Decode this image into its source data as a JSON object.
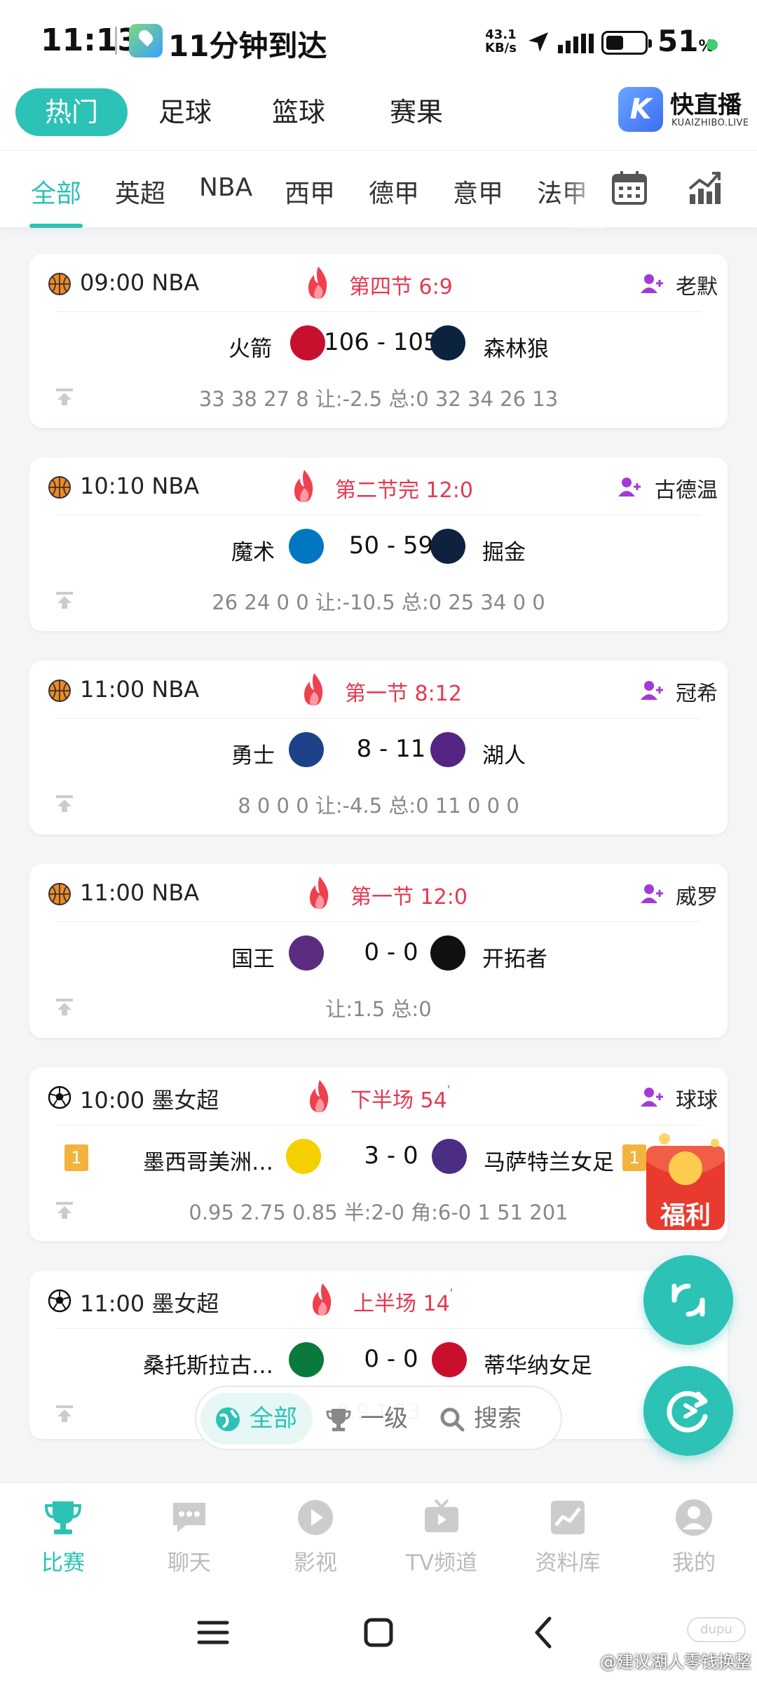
{
  "status_bar": {
    "time": "11:13",
    "eta": "11分钟到达",
    "net_speed_value": "43.1",
    "net_speed_unit": "KB/s",
    "battery_pct": "51",
    "battery_unit": "%"
  },
  "top_nav": {
    "tabs": [
      "热门",
      "足球",
      "篮球",
      "赛果"
    ],
    "active_tab": 0,
    "brand_name": "快直播",
    "brand_sub": "KUAIZHIBO.LIVE",
    "brand_letter": "K"
  },
  "league_tabs": {
    "items": [
      "全部",
      "英超",
      "NBA",
      "西甲",
      "德甲",
      "意甲",
      "法甲"
    ],
    "active": 0,
    "icons": [
      "calendar-icon",
      "trend-chart-icon"
    ]
  },
  "matches": [
    {
      "sport": "basketball",
      "time_league": "09:00 NBA",
      "status": "第四节  6:9",
      "status_mark": "",
      "anchor": "老默",
      "home": "火箭",
      "away": "森林狼",
      "score": "106 - 105",
      "stats": "33  38  27  8  让:-2.5  总:0  32  34  26  13",
      "home_rank": "",
      "away_rank": "",
      "home_color": "#c8102e",
      "away_color": "#0c2340"
    },
    {
      "sport": "basketball",
      "time_league": "10:10 NBA",
      "status": "第二节完  12:0",
      "status_mark": "",
      "anchor": "古德温",
      "home": "魔术",
      "away": "掘金",
      "score": "50 - 59",
      "stats": "26  24  0  0  让:-10.5  总:0  25  34  0  0",
      "home_rank": "",
      "away_rank": "",
      "home_color": "#0077c0",
      "away_color": "#0e2240"
    },
    {
      "sport": "basketball",
      "time_league": "11:00 NBA",
      "status": "第一节  8:12",
      "status_mark": "",
      "anchor": "冠希",
      "home": "勇士",
      "away": "湖人",
      "score": "8 - 11",
      "stats": "8  0  0  0  让:-4.5  总:0  11  0  0  0",
      "home_rank": "",
      "away_rank": "",
      "home_color": "#1d428a",
      "away_color": "#552583"
    },
    {
      "sport": "basketball",
      "time_league": "11:00 NBA",
      "status": "第一节  12:0",
      "status_mark": "",
      "anchor": "威罗",
      "home": "国王",
      "away": "开拓者",
      "score": "0 - 0",
      "stats": "让:1.5  总:0",
      "home_rank": "",
      "away_rank": "",
      "home_color": "#5a2d81",
      "away_color": "#111111"
    },
    {
      "sport": "soccer",
      "time_league": "10:00 墨女超",
      "status": "下半场  54",
      "status_mark": "'",
      "anchor": "球球",
      "home": "墨西哥美洲…",
      "away": "马萨特兰女足",
      "score": "3 - 0",
      "stats": "0.95  2.75  0.85  半:2-0  角:6-0  1  51  201",
      "home_rank": "1",
      "away_rank": "1",
      "home_color": "#f5d000",
      "away_color": "#4b2d83"
    },
    {
      "sport": "soccer",
      "time_league": "11:00 墨女超",
      "status": "上半场  14",
      "status_mark": "'",
      "anchor": "",
      "home": "桑托斯拉古…",
      "away": "蒂华纳女足",
      "score": "0 - 0",
      "stats": "0.9                                                    1.53",
      "home_rank": "",
      "away_rank": "",
      "home_color": "#0a7a3c",
      "away_color": "#c8102e"
    }
  ],
  "floating": {
    "welfare_label": "福利",
    "filter_items": [
      "全部",
      "一级",
      "搜索"
    ],
    "filter_active": 0
  },
  "bottom_tabs": {
    "items": [
      "比赛",
      "聊天",
      "影视",
      "TV频道",
      "资料库",
      "我的"
    ],
    "active": 0
  },
  "watermark": {
    "text": "@建议湖人零钱换整",
    "logo": "dupu"
  },
  "colors": {
    "accent": "#2cc2b5",
    "live_red": "#e53950",
    "anchor_purple": "#a23bd6",
    "rank_badge": "#f3b43d"
  }
}
